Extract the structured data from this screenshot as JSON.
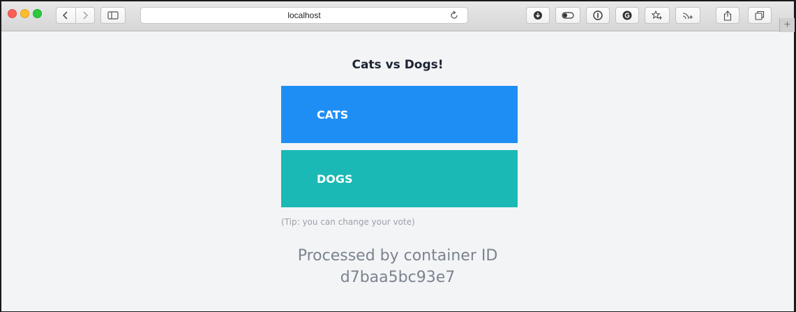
{
  "browser": {
    "address": "localhost",
    "new_tab": "+"
  },
  "page": {
    "title": "Cats vs Dogs!",
    "option_a": "CATS",
    "option_b": "DOGS",
    "tip": "(Tip: you can change your vote)",
    "processed_line1": "Processed by container ID",
    "processed_line2": "d7baa5bc93e7"
  },
  "colors": {
    "cats": "#1e8ef5",
    "dogs": "#1bb9b5"
  }
}
